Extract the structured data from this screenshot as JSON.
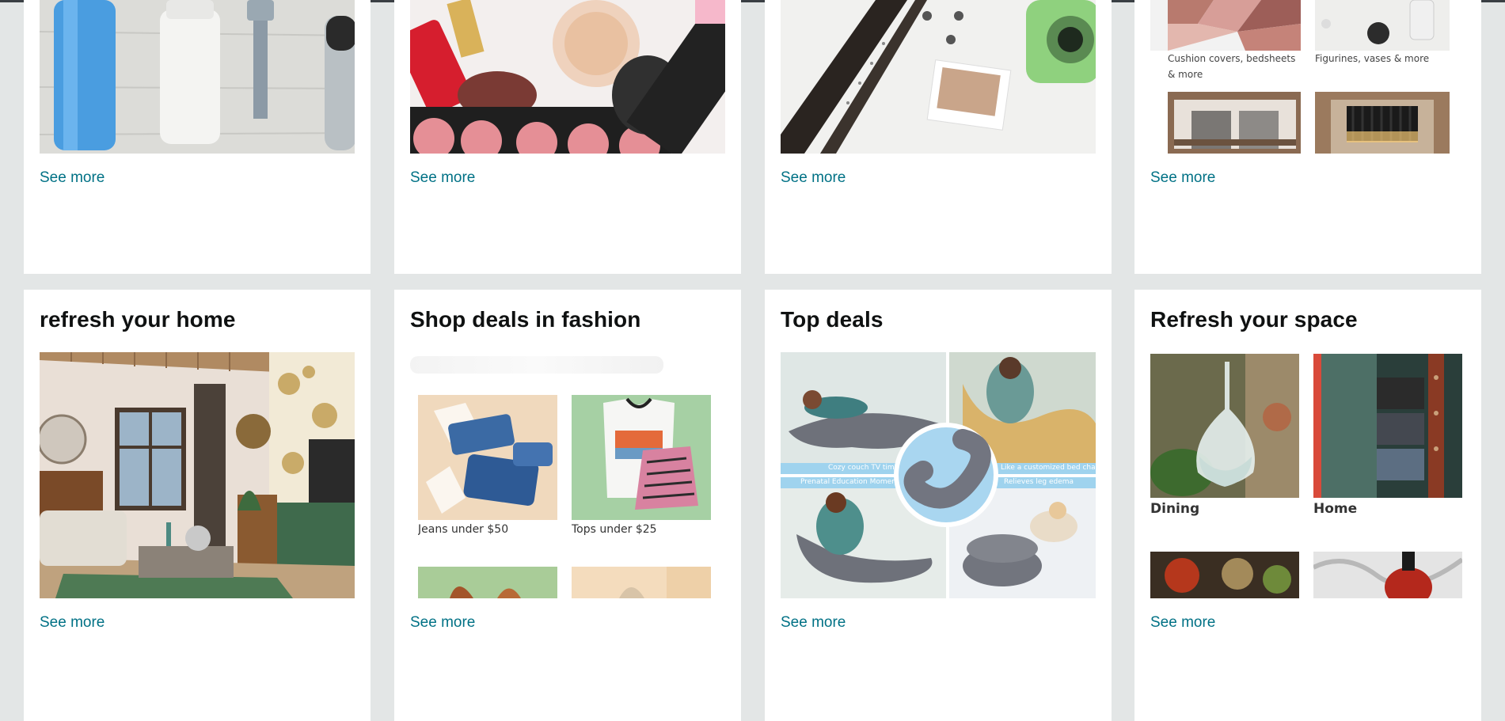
{
  "see_more_label": "See more",
  "colors": {
    "link": "#007185",
    "background": "#e3e6e6",
    "card": "#ffffff"
  },
  "top_row": {
    "cards": [
      {
        "image": "personal-care-products"
      },
      {
        "image": "makeup-cosmetics"
      },
      {
        "image": "guitar-and-instant-camera"
      },
      {
        "tiles": [
          {
            "label": "Cushion covers, bedsheets & more"
          },
          {
            "label": "Figurines, vases & more"
          }
        ]
      }
    ]
  },
  "bottom_row": {
    "cards": [
      {
        "title": "refresh your home",
        "image": "living-room"
      },
      {
        "title": "Shop deals in fashion",
        "tiles": [
          {
            "label": "Jeans under $50"
          },
          {
            "label": "Tops under $25"
          }
        ]
      },
      {
        "title": "Top deals",
        "image": "pregnancy-pillow",
        "captions": [
          "Cozy couch TV time",
          "Like a customized bed chair",
          "Prenatal Education Moment",
          "Relieves leg edema"
        ]
      },
      {
        "title": "Refresh your space",
        "tiles": [
          {
            "label": "Dining"
          },
          {
            "label": "Home"
          }
        ]
      }
    ]
  }
}
